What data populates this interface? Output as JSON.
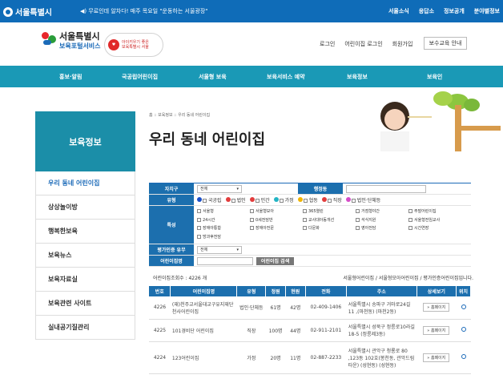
{
  "topbar": {
    "logo": "서울특별시",
    "notice": "◀) 무료인데 알차다! 매주 목요일 \"운동하는 서울광장\"",
    "links": [
      "서울소식",
      "응답소",
      "정보공개",
      "분야별정보"
    ]
  },
  "header": {
    "brand_line1": "서울특별시",
    "brand_line2": "보육포털서비스",
    "badge_line1": "아이키우기 좋은",
    "badge_line2": "보육특별시 서울",
    "links": [
      "로그인",
      "어린이집 로그인",
      "회원가입"
    ],
    "guide_button": "보수교육 안내"
  },
  "nav": {
    "items": [
      "홍보·알림",
      "국공립어린이집",
      "서울형 보육",
      "보육서비스 예약",
      "보육정보",
      "보육인"
    ]
  },
  "sidebar": {
    "title": "보육정보",
    "items": [
      "우리 동네 어린이집",
      "상상놀이방",
      "행복한보육",
      "보육뉴스",
      "보육자료실",
      "보육관련 사이트",
      "실내공기질관리"
    ]
  },
  "breadcrumb": "홈 :: 보육정보 :: 우리 동네 어린이집",
  "page_title": "우리 동네 어린이집",
  "search": {
    "district_label": "자치구",
    "district_value": "전체",
    "dong_label": "행정동",
    "type_label": "유형",
    "types": [
      {
        "label": "국공립",
        "color": "#1b4fc8"
      },
      {
        "label": "법인",
        "color": "#e23c3c"
      },
      {
        "label": "민간",
        "color": "#e23c3c"
      },
      {
        "label": "가정",
        "color": "#23b4c4"
      },
      {
        "label": "협동",
        "color": "#f0b400"
      },
      {
        "label": "직장",
        "color": "#e23c3c"
      },
      {
        "label": "법인·단체등",
        "color": "#d64cc8"
      }
    ],
    "feature_label": "특성",
    "features": [
      "서울형",
      "서울형모아",
      "365열린",
      "거점형야간",
      "주말어린이집",
      "24시간",
      "0세전담반",
      "교사대아동개선",
      "석식지원",
      "서울형전임교사",
      "장애아통합",
      "장애아전문",
      "다문화",
      "영아전담",
      "시간연장",
      "방과후전담"
    ],
    "eval_label": "평가인증 유무",
    "eval_value": "전체",
    "name_label": "어린이집명",
    "search_button": "어린이집 검색"
  },
  "count": {
    "text": "어린이집조회수 : 4226 개",
    "legend": "서울형어린이집 / 서울형모아어린이집 / 평가인증어린이집입니다."
  },
  "table": {
    "headers": [
      "번호",
      "어린이집명",
      "유형",
      "정원",
      "현원",
      "전화",
      "주소",
      "상세보기",
      "위치"
    ],
    "rows": [
      {
        "no": "4226",
        "name": "(재)천주교서울대교구유지재단천사어린이집",
        "type": "법인·단체등",
        "cap": "61명",
        "cur": "42명",
        "tel": "02-409-1406",
        "addr": "서울특별시 송파구 거마로24길 11 ,(마천동) (마천2동)",
        "btn": "» 홈페이지"
      },
      {
        "no": "4225",
        "name": "101경비단 어린이집",
        "type": "직장",
        "cap": "100명",
        "cur": "44명",
        "tel": "02-911-2101",
        "addr": "서울특별시 성북구 정릉로10라길 18-5 (정릉제3동)",
        "btn": "» 홈페이지"
      },
      {
        "no": "4224",
        "name": "123어린이집",
        "type": "가정",
        "cap": "20명",
        "cur": "11명",
        "tel": "02-887-2233",
        "addr": "서울특별시 관악구 청룡로 80 ,123동 102호(봉천동, 관악드림타운) (성현동) (성현동)",
        "btn": "» 홈페이지"
      }
    ]
  }
}
